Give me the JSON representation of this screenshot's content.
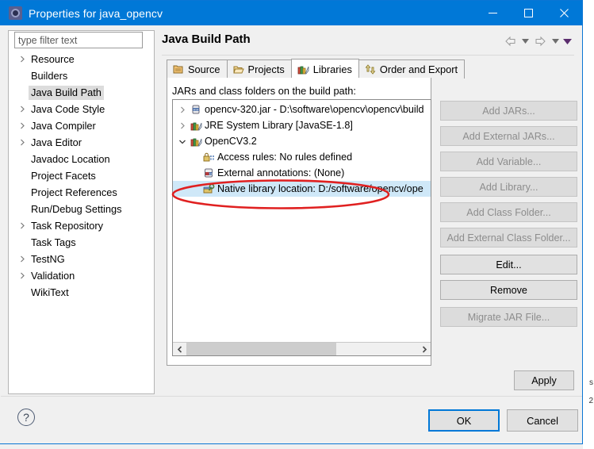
{
  "window": {
    "title": "Properties for java_opencv",
    "icon": "properties-gear-icon",
    "minimize_label": "Minimize",
    "maximize_label": "Maximize",
    "close_label": "Close",
    "titlebar_color": "#0078d7"
  },
  "sidebar": {
    "filter": {
      "value": "",
      "placeholder": "type filter text"
    },
    "items": [
      {
        "label": "Resource",
        "expandable": true,
        "selected": false
      },
      {
        "label": "Builders",
        "expandable": false,
        "selected": false
      },
      {
        "label": "Java Build Path",
        "expandable": false,
        "selected": true
      },
      {
        "label": "Java Code Style",
        "expandable": true,
        "selected": false
      },
      {
        "label": "Java Compiler",
        "expandable": true,
        "selected": false
      },
      {
        "label": "Java Editor",
        "expandable": true,
        "selected": false
      },
      {
        "label": "Javadoc Location",
        "expandable": false,
        "selected": false
      },
      {
        "label": "Project Facets",
        "expandable": false,
        "selected": false
      },
      {
        "label": "Project References",
        "expandable": false,
        "selected": false
      },
      {
        "label": "Run/Debug Settings",
        "expandable": false,
        "selected": false
      },
      {
        "label": "Task Repository",
        "expandable": true,
        "selected": false
      },
      {
        "label": "Task Tags",
        "expandable": false,
        "selected": false
      },
      {
        "label": "TestNG",
        "expandable": true,
        "selected": false
      },
      {
        "label": "Validation",
        "expandable": true,
        "selected": false
      },
      {
        "label": "WikiText",
        "expandable": false,
        "selected": false
      }
    ]
  },
  "main": {
    "page_title": "Java Build Path",
    "nav": {
      "back_icon": "back-arrow-icon",
      "back_dropdown_icon": "chevron-down-icon",
      "forward_icon": "forward-arrow-icon",
      "forward_dropdown_icon": "chevron-down-icon",
      "menu_icon": "triangle-down-icon"
    },
    "tabs": [
      {
        "label": "Source",
        "icon": "package-icon",
        "active": false
      },
      {
        "label": "Projects",
        "icon": "folder-icon",
        "active": false
      },
      {
        "label": "Libraries",
        "icon": "library-books-icon",
        "active": true
      },
      {
        "label": "Order and Export",
        "icon": "order-arrows-icon",
        "active": false
      }
    ],
    "jars_label": "JARs and class folders on the build path:",
    "tree": [
      {
        "label": "opencv-320.jar - D:\\software\\opencv\\opencv\\build",
        "icon": "jar-icon",
        "expander": "collapsed",
        "indent": 0,
        "selected": false
      },
      {
        "label": "JRE System Library [JavaSE-1.8]",
        "icon": "library-books-icon",
        "expander": "collapsed",
        "indent": 0,
        "selected": false
      },
      {
        "label": "OpenCV3.2",
        "icon": "library-books-icon",
        "expander": "expanded",
        "indent": 0,
        "selected": false
      },
      {
        "label": "Access rules: No rules defined",
        "icon": "access-rules-icon",
        "expander": "none",
        "indent": 1,
        "selected": false
      },
      {
        "label": "External annotations: (None)",
        "icon": "annotation-jar-icon",
        "expander": "none",
        "indent": 1,
        "selected": false
      },
      {
        "label": "Native library location: D:/software/opencv/ope",
        "icon": "native-library-icon",
        "expander": "none",
        "indent": 1,
        "selected": true
      }
    ],
    "scrollbar": {
      "left_icon": "scroll-left-icon",
      "right_icon": "scroll-right-icon",
      "thumb_percent": 65
    },
    "buttons": [
      {
        "label": "Add JARs...",
        "enabled": false
      },
      {
        "label": "Add External JARs...",
        "enabled": false
      },
      {
        "label": "Add Variable...",
        "enabled": false
      },
      {
        "label": "Add Library...",
        "enabled": false
      },
      {
        "label": "Add Class Folder...",
        "enabled": false
      },
      {
        "label": "Add External Class Folder...",
        "enabled": false
      },
      {
        "label": "Edit...",
        "enabled": true
      },
      {
        "label": "Remove",
        "enabled": true
      },
      {
        "label": "Migrate JAR File...",
        "enabled": false
      }
    ],
    "apply_label": "Apply"
  },
  "footer": {
    "help_icon": "help-question-icon",
    "help_glyph": "?",
    "ok_label": "OK",
    "cancel_label": "Cancel"
  },
  "annotation": {
    "shape": "red-ellipse-highlight",
    "color": "#e02020",
    "target": "Native library location row"
  }
}
